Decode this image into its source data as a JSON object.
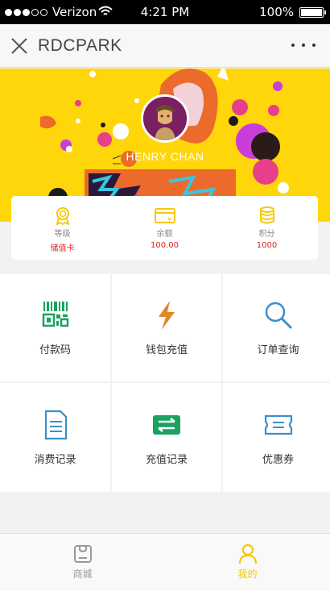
{
  "status_bar": {
    "carrier": "Verizon",
    "time": "4:21 PM",
    "battery": "100%"
  },
  "nav": {
    "title": "RDCPARK"
  },
  "banner": {
    "username": "HENRY CHAN"
  },
  "stats": [
    {
      "icon": "medal-icon",
      "label": "等级",
      "value": "储值卡"
    },
    {
      "icon": "wallet-card-icon",
      "label": "余额",
      "value": "100.00"
    },
    {
      "icon": "coins-icon",
      "label": "积分",
      "value": "1000"
    }
  ],
  "grid": [
    {
      "icon": "barcode-qr-icon",
      "label": "付款码",
      "color": "#1aa260"
    },
    {
      "icon": "lightning-icon",
      "label": "钱包充值",
      "color": "#e0872a"
    },
    {
      "icon": "search-icon",
      "label": "订单查询",
      "color": "#3d8ec7"
    },
    {
      "icon": "document-icon",
      "label": "消费记录",
      "color": "#3d8ec7"
    },
    {
      "icon": "exchange-icon",
      "label": "充值记录",
      "color": "#1aa260"
    },
    {
      "icon": "coupon-icon",
      "label": "优惠券",
      "color": "#3d8ec7"
    }
  ],
  "tabs": [
    {
      "icon": "shop-icon",
      "label": "商城",
      "active": false
    },
    {
      "icon": "user-icon",
      "label": "我的",
      "active": true
    }
  ],
  "colors": {
    "accent": "#f5c800",
    "banner": "#ffd60a",
    "value_red": "#e02020"
  }
}
